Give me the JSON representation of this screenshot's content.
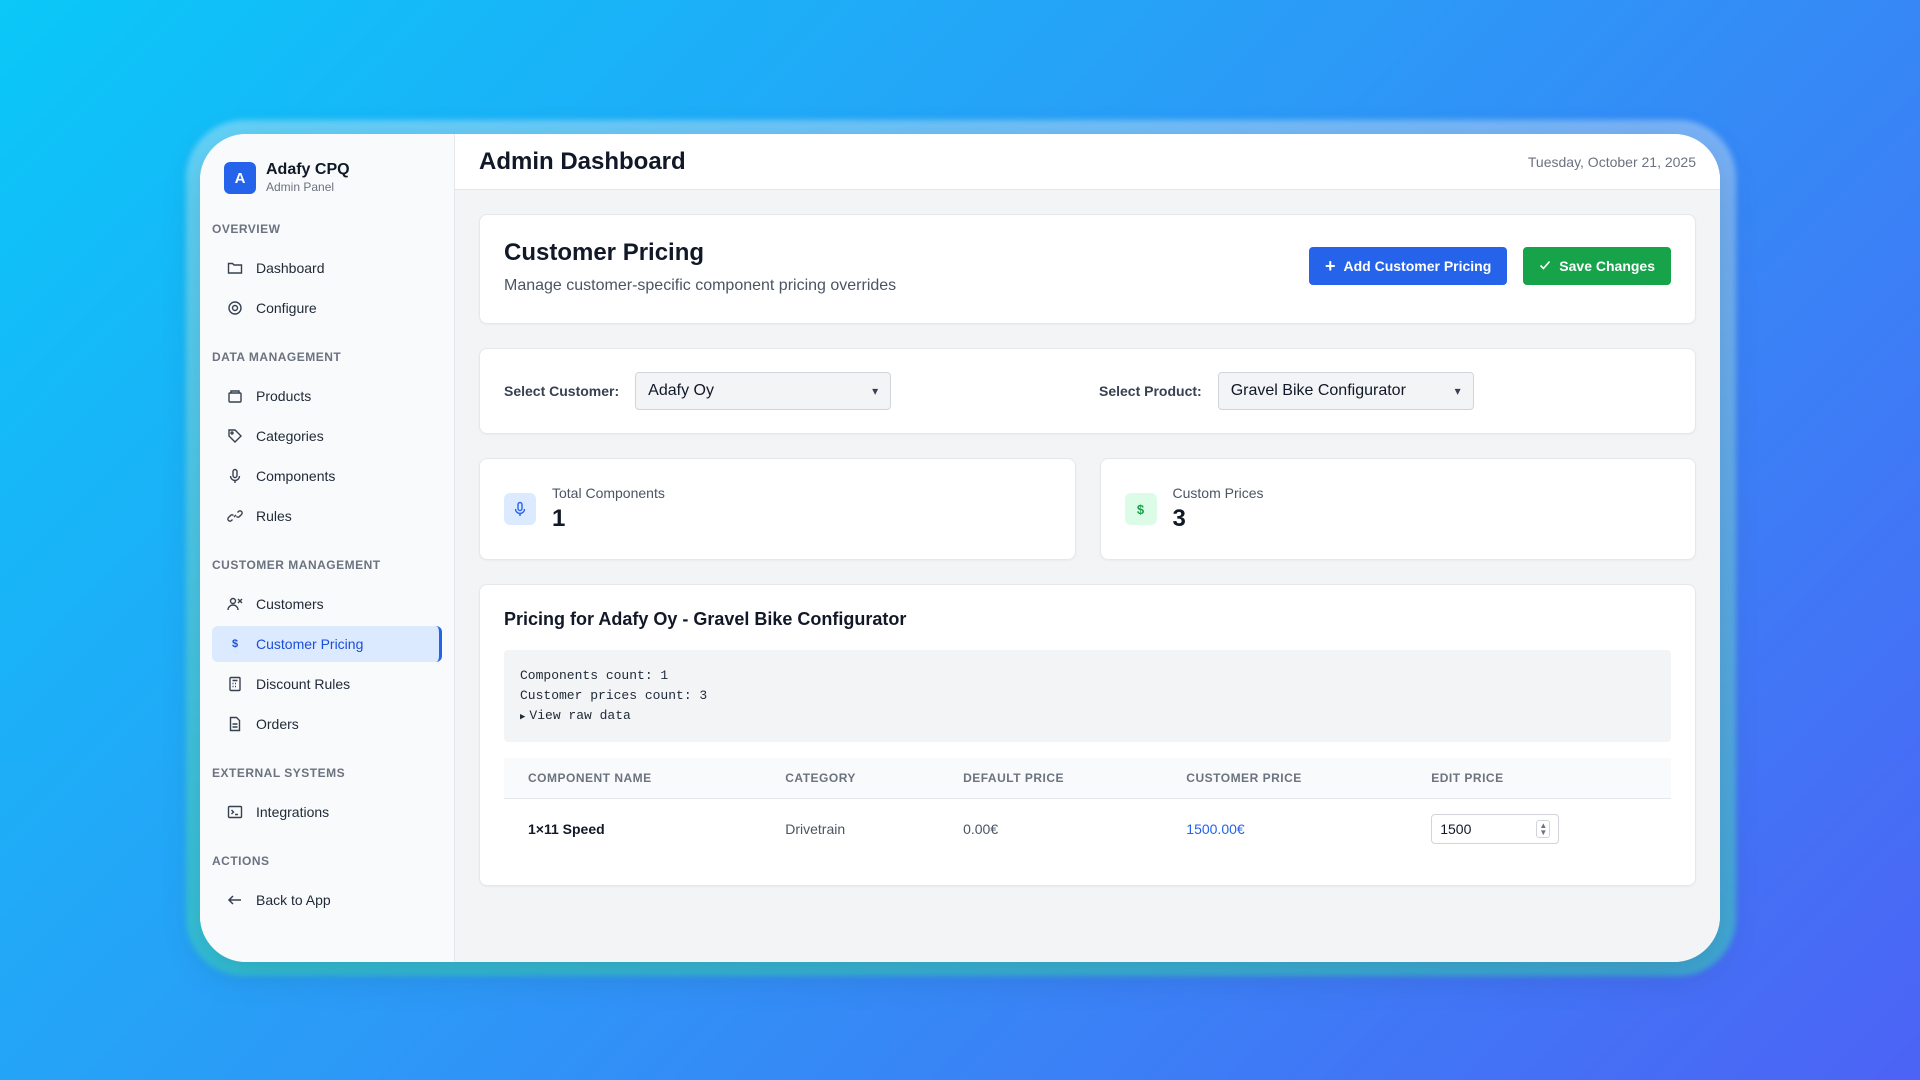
{
  "brand": {
    "initial": "A",
    "title": "Adafy CPQ",
    "subtitle": "Admin Panel"
  },
  "sidebar": {
    "sections": [
      {
        "label": "OVERVIEW",
        "items": [
          {
            "label": "Dashboard",
            "icon": "folder-icon"
          },
          {
            "label": "Configure",
            "icon": "gear-icon"
          }
        ]
      },
      {
        "label": "DATA MANAGEMENT",
        "items": [
          {
            "label": "Products",
            "icon": "box-icon"
          },
          {
            "label": "Categories",
            "icon": "tag-icon"
          },
          {
            "label": "Components",
            "icon": "microphone-icon"
          },
          {
            "label": "Rules",
            "icon": "link-icon"
          }
        ]
      },
      {
        "label": "CUSTOMER MANAGEMENT",
        "items": [
          {
            "label": "Customers",
            "icon": "users-icon"
          },
          {
            "label": "Customer Pricing",
            "icon": "dollar-icon",
            "active": true
          },
          {
            "label": "Discount Rules",
            "icon": "calculator-icon"
          },
          {
            "label": "Orders",
            "icon": "document-icon"
          }
        ]
      },
      {
        "label": "EXTERNAL SYSTEMS",
        "items": [
          {
            "label": "Integrations",
            "icon": "terminal-icon"
          }
        ]
      },
      {
        "label": "ACTIONS",
        "items": [
          {
            "label": "Back to App",
            "icon": "arrow-left-icon"
          }
        ]
      }
    ]
  },
  "topbar": {
    "title": "Admin Dashboard",
    "date": "Tuesday, October 21, 2025"
  },
  "header": {
    "title": "Customer Pricing",
    "subtitle": "Manage customer-specific component pricing overrides",
    "add_button": "Add Customer Pricing",
    "save_button": "Save Changes"
  },
  "filters": {
    "customer_label": "Select Customer:",
    "customer_value": "Adafy Oy",
    "product_label": "Select Product:",
    "product_value": "Gravel Bike Configurator"
  },
  "stats": {
    "total_label": "Total Components",
    "total_value": "1",
    "custom_label": "Custom Prices",
    "custom_value": "3",
    "custom_icon_glyph": "$"
  },
  "pricing": {
    "title": "Pricing for Adafy Oy - Gravel Bike Configurator",
    "debug_line1": "Components count: 1",
    "debug_line2": "Customer prices count: 3",
    "debug_toggle": "View raw data",
    "columns": [
      "COMPONENT NAME",
      "CATEGORY",
      "DEFAULT PRICE",
      "CUSTOMER PRICE",
      "EDIT PRICE"
    ],
    "rows": [
      {
        "name": "1×11 Speed",
        "category": "Drivetrain",
        "default_price": "0.00€",
        "customer_price": "1500.00€",
        "edit_value": "1500"
      }
    ]
  },
  "colors": {
    "accent": "#2563eb",
    "success": "#16a34a"
  }
}
